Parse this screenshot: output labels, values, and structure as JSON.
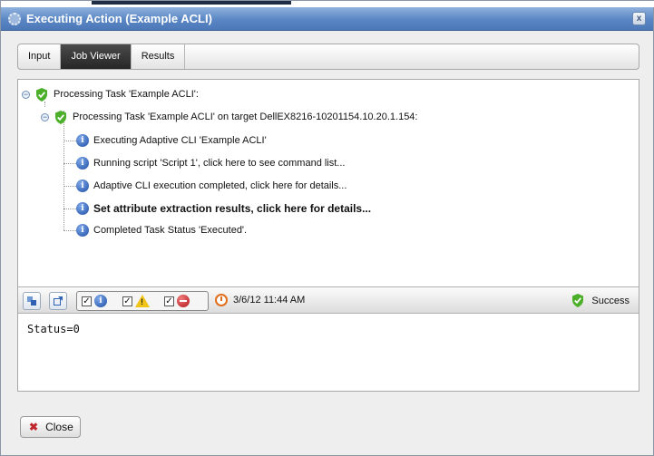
{
  "window": {
    "title": "Executing Action (Example ACLI)",
    "close_glyph": "x"
  },
  "tabs": [
    {
      "label": "Input",
      "active": false
    },
    {
      "label": "Job Viewer",
      "active": true
    },
    {
      "label": "Results",
      "active": false
    }
  ],
  "tree": {
    "root": {
      "toggle": "−",
      "label": "Processing Task 'Example ACLI':"
    },
    "child": {
      "toggle": "−",
      "label": "Processing Task 'Example ACLI' on target DellEX8216-10201154.10.20.1.154:"
    },
    "items": [
      {
        "label": "Executing Adaptive CLI 'Example ACLI'",
        "bold": false
      },
      {
        "label": "Running script 'Script 1', click here to see command list...",
        "bold": false
      },
      {
        "label": "Adaptive CLI execution completed, click here for details...",
        "bold": false
      },
      {
        "label": "Set attribute extraction results, click here for details...",
        "bold": true
      },
      {
        "label": "Completed Task Status 'Executed'.",
        "bold": false
      }
    ]
  },
  "toolbar": {
    "filters": {
      "info": "✓",
      "warning": "✓",
      "error": "✓"
    },
    "datetime": "3/6/12 11:44 AM",
    "status": "Success"
  },
  "output": {
    "text": "Status=0"
  },
  "footer": {
    "close_label": "Close",
    "close_glyph": "✖"
  },
  "colors": {
    "title_bar": "#5a86c4",
    "success_green": "#4caf2a",
    "info_blue": "#1e4fa6",
    "error_red": "#c0262d"
  }
}
